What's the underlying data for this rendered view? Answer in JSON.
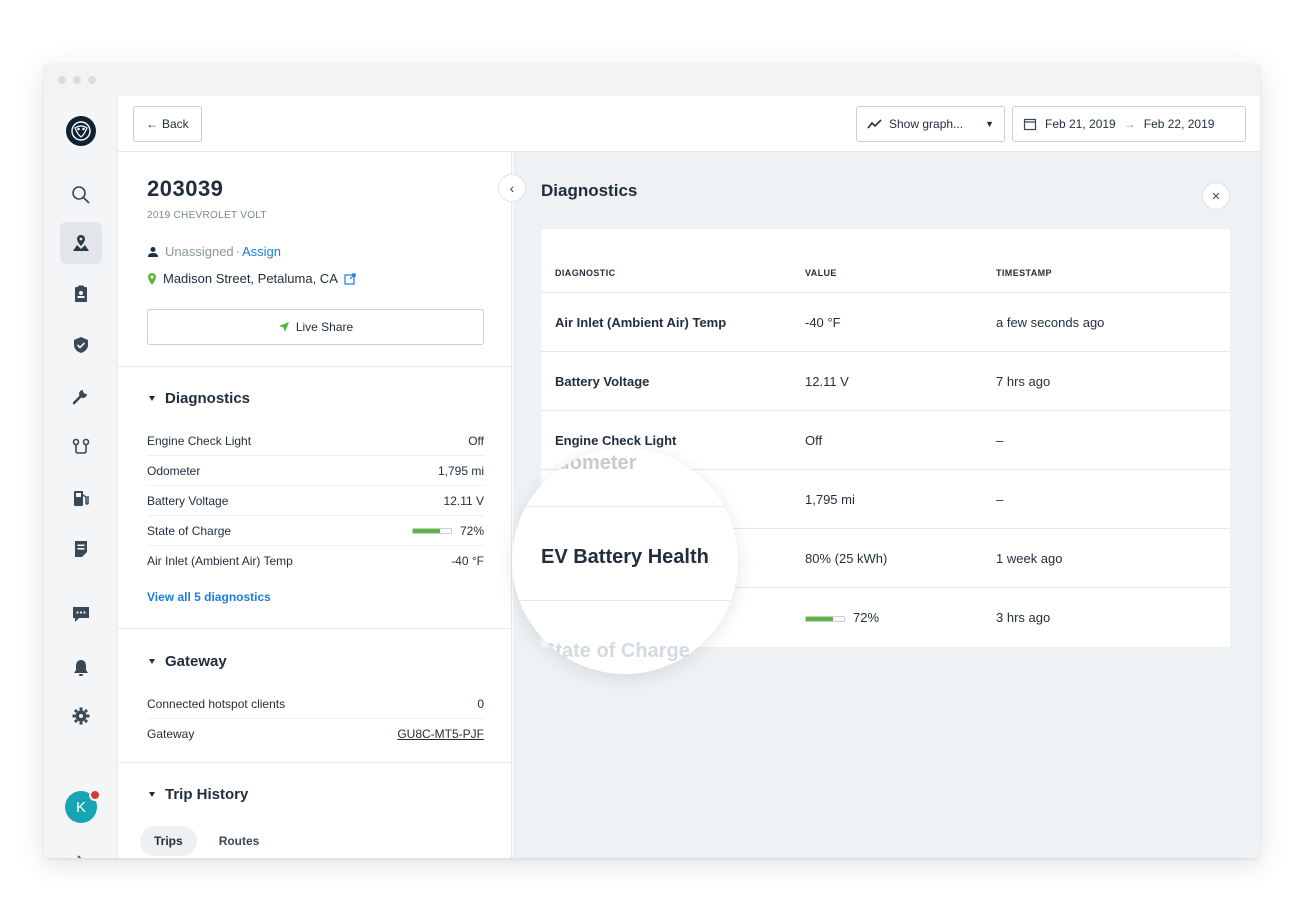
{
  "window": {
    "dots": 3
  },
  "sidebar": {
    "items": [
      {
        "icon": "search-icon"
      },
      {
        "icon": "map-pin-icon",
        "active": true
      },
      {
        "icon": "clipboard-icon"
      },
      {
        "icon": "shield-icon"
      },
      {
        "icon": "wrench-icon"
      },
      {
        "icon": "route-icon"
      },
      {
        "icon": "fuel-icon"
      },
      {
        "icon": "document-icon"
      },
      {
        "icon": "chat-icon"
      },
      {
        "icon": "bell-icon"
      },
      {
        "icon": "gear-icon"
      }
    ],
    "avatar_initial": "K",
    "expand_icon": "chevron-right-icon"
  },
  "topbar": {
    "back_label": "Back",
    "graph_label": "Show graph...",
    "date_start": "Feb 21, 2019",
    "date_end": "Feb 22, 2019"
  },
  "vehicle": {
    "id": "203039",
    "model": "2019 CHEVROLET VOLT",
    "driver_status": "Unassigned",
    "separator": "·",
    "assign_label": "Assign",
    "location": "Madison Street, Petaluma, CA",
    "live_share_label": "Live Share"
  },
  "diagnostics_summary": {
    "title": "Diagnostics",
    "rows": [
      {
        "label": "Engine Check Light",
        "value": "Off"
      },
      {
        "label": "Odometer",
        "value": "1,795 mi"
      },
      {
        "label": "Battery Voltage",
        "value": "12.11 V"
      },
      {
        "label": "State of Charge",
        "value": "72%",
        "charge_fraction": 0.72
      },
      {
        "label": "Air Inlet (Ambient Air) Temp",
        "value": "-40 °F"
      }
    ],
    "view_all_label": "View all 5 diagnostics"
  },
  "gateway": {
    "title": "Gateway",
    "rows": [
      {
        "label": "Connected hotspot clients",
        "value": "0"
      },
      {
        "label": "Gateway",
        "value": "GU8C-MT5-PJF"
      }
    ]
  },
  "trip_history": {
    "title": "Trip History",
    "tabs": [
      {
        "label": "Trips",
        "active": true
      },
      {
        "label": "Routes",
        "active": false
      }
    ]
  },
  "diagnostics_panel": {
    "title": "Diagnostics",
    "columns": [
      "DIAGNOSTIC",
      "VALUE",
      "TIMESTAMP"
    ],
    "rows": [
      {
        "diagnostic": "Air Inlet (Ambient Air) Temp",
        "value": "-40 °F",
        "timestamp": "a few seconds ago"
      },
      {
        "diagnostic": "Battery Voltage",
        "value": "12.11 V",
        "timestamp": "7 hrs ago"
      },
      {
        "diagnostic": "Engine Check Light",
        "value": "Off",
        "timestamp": "–"
      },
      {
        "diagnostic": "",
        "value": "1,795 mi",
        "timestamp": "–"
      },
      {
        "diagnostic": "",
        "value": "80% (25 kWh)",
        "timestamp": "1 week ago"
      },
      {
        "diagnostic": "",
        "value": "72%",
        "timestamp": "3 hrs ago",
        "charge_fraction": 0.72
      }
    ]
  },
  "magnifier": {
    "ghost_top": "Odometer",
    "main": "EV Battery Health",
    "ghost_bottom": "State of Charge"
  },
  "colors": {
    "accent_link": "#1a7fdc",
    "charge_green": "#5cb63c",
    "avatar": "#19a4b5",
    "notification": "#d63b2f",
    "logo_bg": "#0f2233"
  }
}
